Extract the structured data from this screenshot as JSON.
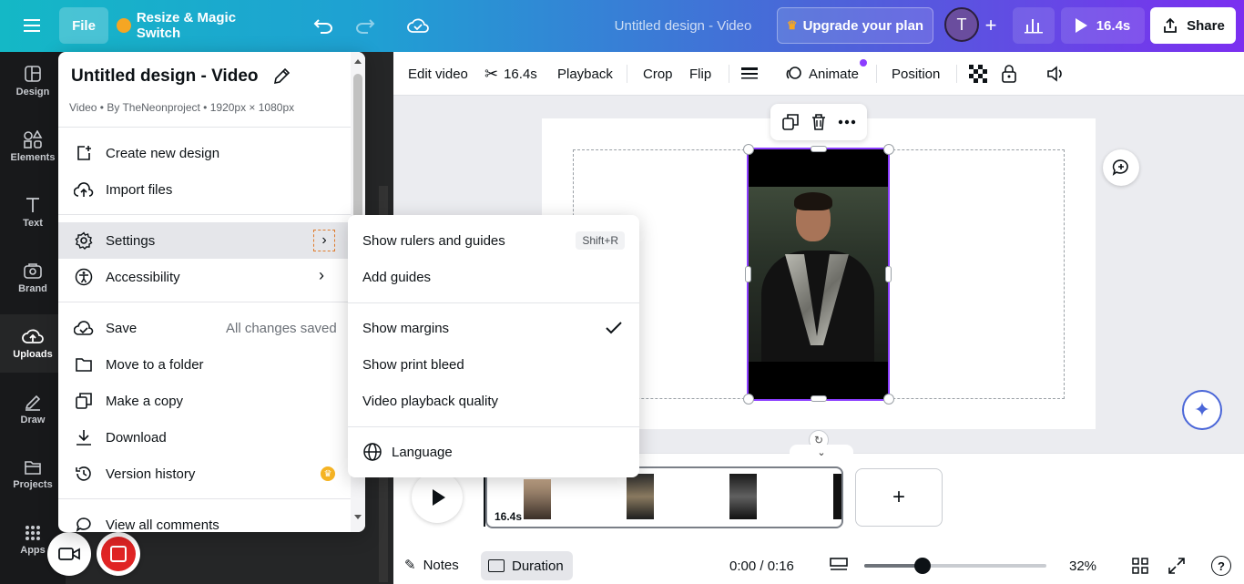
{
  "topbar": {
    "file_label": "File",
    "resize_label": "Resize & Magic Switch",
    "doc_title": "Untitled design - Video",
    "upgrade_label": "Upgrade your plan",
    "avatar_initial": "T",
    "play_duration": "16.4s",
    "share_label": "Share"
  },
  "rail": {
    "items": [
      {
        "label": "Design",
        "icon": "design-icon"
      },
      {
        "label": "Elements",
        "icon": "elements-icon"
      },
      {
        "label": "Text",
        "icon": "text-icon"
      },
      {
        "label": "Brand",
        "icon": "brand-icon"
      },
      {
        "label": "Uploads",
        "icon": "uploads-icon"
      },
      {
        "label": "Draw",
        "icon": "draw-icon"
      },
      {
        "label": "Projects",
        "icon": "projects-icon"
      },
      {
        "label": "Apps",
        "icon": "apps-icon"
      }
    ]
  },
  "file_menu": {
    "title": "Untitled design - Video",
    "meta": "Video • By TheNeonproject • 1920px × 1080px",
    "items": {
      "create": "Create new design",
      "import": "Import files",
      "settings": "Settings",
      "accessibility": "Accessibility",
      "save": "Save",
      "save_status": "All changes saved",
      "move": "Move to a folder",
      "copy": "Make a copy",
      "download": "Download",
      "version": "Version history",
      "comments": "View all comments"
    }
  },
  "settings_menu": {
    "rulers": "Show rulers and guides",
    "rulers_shortcut": "Shift+R",
    "guides": "Add guides",
    "margins": "Show margins",
    "bleed": "Show print bleed",
    "quality": "Video playback quality",
    "language": "Language"
  },
  "toolbar": {
    "edit_video": "Edit video",
    "trim_duration": "16.4s",
    "playback": "Playback",
    "crop": "Crop",
    "flip": "Flip",
    "animate": "Animate",
    "position": "Position"
  },
  "timeline": {
    "clip_duration": "16.4s"
  },
  "bottombar": {
    "notes": "Notes",
    "duration": "Duration",
    "time": "0:00 / 0:16",
    "zoom": "32%",
    "zoom_fraction": 0.32
  },
  "colors": {
    "accent": "#8b3dff",
    "record": "#e02424"
  }
}
